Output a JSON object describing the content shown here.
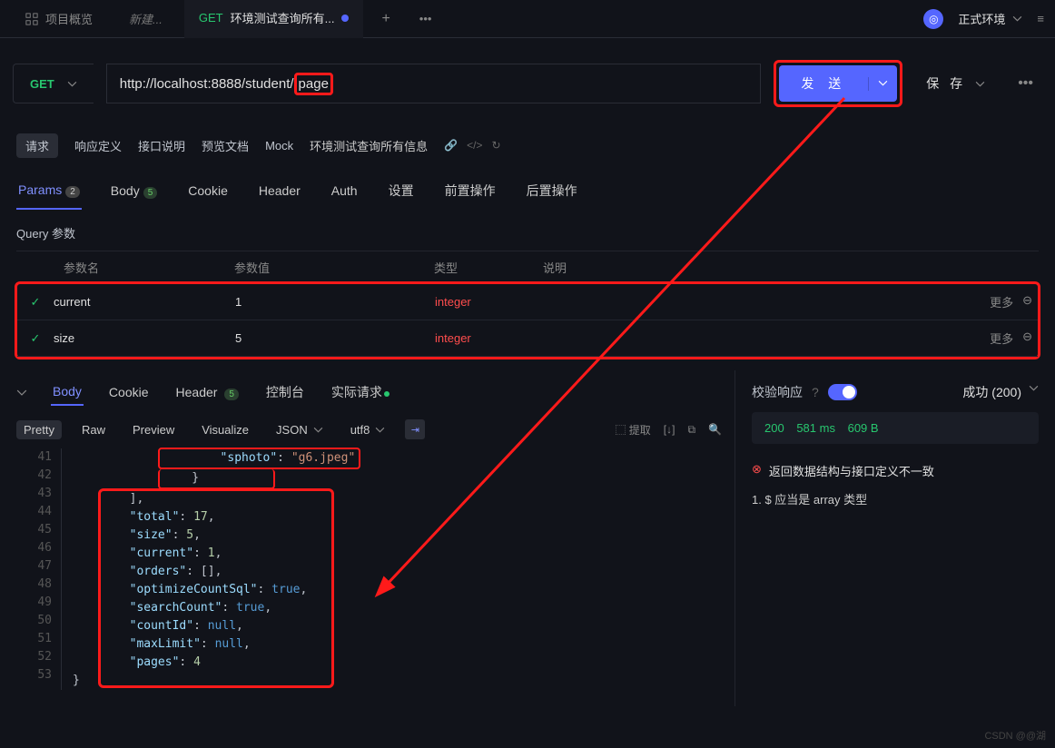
{
  "topbar": {
    "overview": "项目概览",
    "new_tab": "新建...",
    "active_tab": {
      "method": "GET",
      "title": "环境测试查询所有..."
    },
    "env_label": "正式环境"
  },
  "request": {
    "method": "GET",
    "url_prefix": "http://localhost:8888/student/",
    "url_highlight": "page",
    "send": "发 送",
    "save": "保 存"
  },
  "doc_tabs": {
    "request": "请求",
    "response_def": "响应定义",
    "api_desc": "接口说明",
    "preview": "预览文档",
    "mock": "Mock",
    "title": "环境测试查询所有信息"
  },
  "req_tabs": {
    "params": "Params",
    "params_badge": "2",
    "body": "Body",
    "body_badge": "5",
    "cookie": "Cookie",
    "header": "Header",
    "auth": "Auth",
    "settings": "设置",
    "pre": "前置操作",
    "post": "后置操作"
  },
  "query": {
    "section_title": "Query 参数",
    "headers": {
      "name": "参数名",
      "value": "参数值",
      "type": "类型",
      "desc": "说明"
    },
    "rows": [
      {
        "name": "current",
        "value": "1",
        "type": "integer"
      },
      {
        "name": "size",
        "value": "5",
        "type": "integer"
      }
    ],
    "more": "更多"
  },
  "resp_tabs": {
    "body": "Body",
    "cookie": "Cookie",
    "header": "Header",
    "header_badge": "5",
    "console": "控制台",
    "actual": "实际请求"
  },
  "format": {
    "pretty": "Pretty",
    "raw": "Raw",
    "preview": "Preview",
    "visualize": "Visualize",
    "json": "JSON",
    "utf8": "utf8",
    "extract": "提取"
  },
  "code": {
    "lines": [
      {
        "n": 41,
        "indent": 5,
        "sphoto_k": "\"sphoto\"",
        "sphoto_v": "\"g6.jpeg\""
      },
      {
        "n": 42,
        "indent": 4,
        "text": "}"
      },
      {
        "n": 43,
        "indent": 2,
        "text": "],"
      },
      {
        "n": 44,
        "indent": 2,
        "k": "\"total\"",
        "v": "17",
        "t": "num"
      },
      {
        "n": 45,
        "indent": 2,
        "k": "\"size\"",
        "v": "5",
        "t": "num"
      },
      {
        "n": 46,
        "indent": 2,
        "k": "\"current\"",
        "v": "1",
        "t": "num"
      },
      {
        "n": 47,
        "indent": 2,
        "k": "\"orders\"",
        "v": "[]",
        "t": "punct"
      },
      {
        "n": 48,
        "indent": 2,
        "k": "\"optimizeCountSql\"",
        "v": "true",
        "t": "bool"
      },
      {
        "n": 49,
        "indent": 2,
        "k": "\"searchCount\"",
        "v": "true",
        "t": "bool"
      },
      {
        "n": 50,
        "indent": 2,
        "k": "\"countId\"",
        "v": "null",
        "t": "null"
      },
      {
        "n": 51,
        "indent": 2,
        "k": "\"maxLimit\"",
        "v": "null",
        "t": "null"
      },
      {
        "n": 52,
        "indent": 2,
        "k": "\"pages\"",
        "v": "4",
        "t": "num",
        "last": true
      },
      {
        "n": 53,
        "indent": 0,
        "text": "}"
      }
    ]
  },
  "validate": {
    "title": "校验响应",
    "success": "成功 (200)",
    "status_code": "200",
    "time": "581 ms",
    "size": "609 B",
    "error_msg": "返回数据结构与接口定义不一致",
    "error_detail": "1. $ 应当是 array 类型"
  },
  "watermark": "CSDN @@湖"
}
